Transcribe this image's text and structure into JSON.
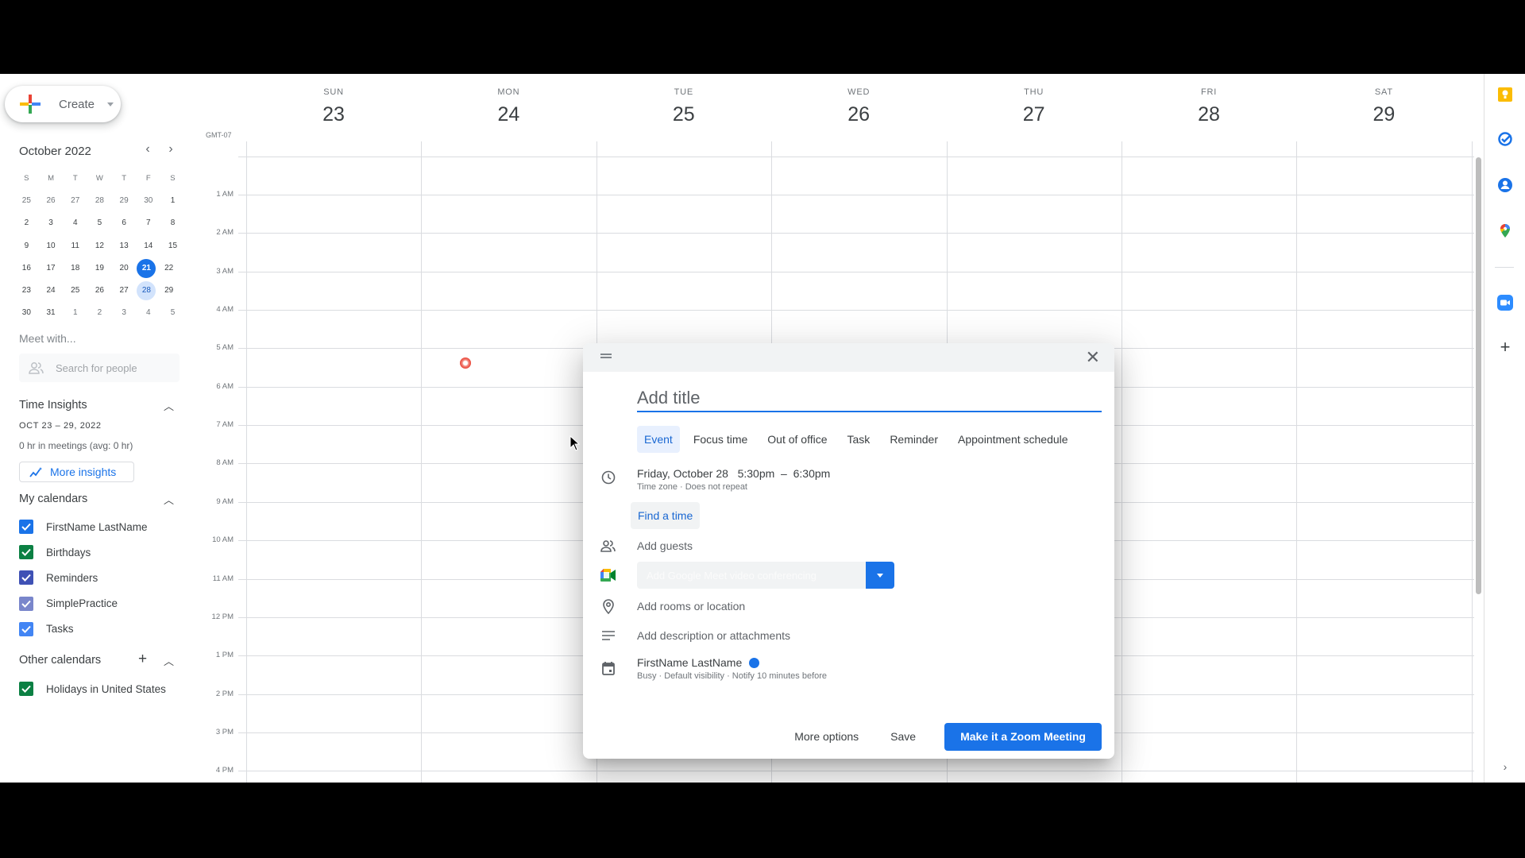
{
  "sidebar": {
    "create_label": "Create",
    "mini_calendar": {
      "title": "October 2022",
      "weekday_headers": [
        "S",
        "M",
        "T",
        "W",
        "T",
        "F",
        "S"
      ],
      "weeks": [
        [
          {
            "d": "25",
            "muted": true
          },
          {
            "d": "26",
            "muted": true
          },
          {
            "d": "27",
            "muted": true
          },
          {
            "d": "28",
            "muted": true
          },
          {
            "d": "29",
            "muted": true
          },
          {
            "d": "30",
            "muted": true
          },
          {
            "d": "1"
          }
        ],
        [
          {
            "d": "2"
          },
          {
            "d": "3"
          },
          {
            "d": "4"
          },
          {
            "d": "5"
          },
          {
            "d": "6"
          },
          {
            "d": "7"
          },
          {
            "d": "8"
          }
        ],
        [
          {
            "d": "9"
          },
          {
            "d": "10"
          },
          {
            "d": "11"
          },
          {
            "d": "12"
          },
          {
            "d": "13"
          },
          {
            "d": "14"
          },
          {
            "d": "15"
          }
        ],
        [
          {
            "d": "16"
          },
          {
            "d": "17"
          },
          {
            "d": "18"
          },
          {
            "d": "19"
          },
          {
            "d": "20"
          },
          {
            "d": "21",
            "today": true
          },
          {
            "d": "22"
          }
        ],
        [
          {
            "d": "23"
          },
          {
            "d": "24"
          },
          {
            "d": "25"
          },
          {
            "d": "26"
          },
          {
            "d": "27"
          },
          {
            "d": "28",
            "selected": true
          },
          {
            "d": "29"
          }
        ],
        [
          {
            "d": "30"
          },
          {
            "d": "31"
          },
          {
            "d": "1",
            "muted": true
          },
          {
            "d": "2",
            "muted": true
          },
          {
            "d": "3",
            "muted": true
          },
          {
            "d": "4",
            "muted": true
          },
          {
            "d": "5",
            "muted": true
          }
        ]
      ]
    },
    "meet_with": "Meet with...",
    "search_people_placeholder": "Search for people",
    "time_insights": {
      "title": "Time Insights",
      "range": "OCT 23 – 29, 2022",
      "meetings": "0 hr in meetings (avg: 0 hr)",
      "more_insights": "More insights"
    },
    "my_calendars": {
      "title": "My calendars",
      "items": [
        {
          "label": "FirstName LastName",
          "color": "#1a73e8",
          "checked": true
        },
        {
          "label": "Birthdays",
          "color": "#0b8043",
          "checked": true
        },
        {
          "label": "Reminders",
          "color": "#3f51b5",
          "checked": true
        },
        {
          "label": "SimplePractice",
          "color": "#7986cb",
          "checked": true
        },
        {
          "label": "Tasks",
          "color": "#4285f4",
          "checked": true
        }
      ]
    },
    "other_calendars": {
      "title": "Other calendars",
      "items": [
        {
          "label": "Holidays in United States",
          "color": "#0b8043",
          "checked": true
        }
      ]
    }
  },
  "week": {
    "timezone": "GMT-07",
    "days": [
      {
        "name": "SUN",
        "num": "23"
      },
      {
        "name": "MON",
        "num": "24"
      },
      {
        "name": "TUE",
        "num": "25"
      },
      {
        "name": "WED",
        "num": "26"
      },
      {
        "name": "THU",
        "num": "27"
      },
      {
        "name": "FRI",
        "num": "28"
      },
      {
        "name": "SAT",
        "num": "29"
      }
    ],
    "hours": [
      "1 AM",
      "2 AM",
      "3 AM",
      "4 AM",
      "5 AM",
      "6 AM",
      "7 AM",
      "8 AM",
      "9 AM",
      "10 AM",
      "11 AM",
      "12 PM",
      "1 PM",
      "2 PM",
      "3 PM",
      "4 PM"
    ]
  },
  "right_rail": [
    "keep-icon",
    "tasks-icon",
    "contacts-icon",
    "maps-icon",
    "zoom-icon",
    "add-addon-icon"
  ],
  "dialog": {
    "title_placeholder": "Add title",
    "tabs": [
      "Event",
      "Focus time",
      "Out of office",
      "Task",
      "Reminder",
      "Appointment schedule"
    ],
    "active_tab": "Event",
    "datetime": "Friday, October 28   5:30pm  –  6:30pm",
    "datetime_sub": "Time zone · Does not repeat",
    "find_time": "Find a time",
    "add_guests": "Add guests",
    "conferencing_label": "Add Google Meet video conferencing",
    "add_location": "Add rooms or location",
    "add_description": "Add description or attachments",
    "calendar_owner": "FirstName LastName",
    "calendar_owner_color": "#1a73e8",
    "calendar_sub": "Busy · Default visibility · Notify 10 minutes before",
    "more_options": "More options",
    "save": "Save",
    "zoom_meeting": "Make it a Zoom Meeting"
  },
  "colors": {
    "accent": "#1a73e8",
    "today": "#1a73e8",
    "selected_day_bg": "#d2e3fc"
  }
}
